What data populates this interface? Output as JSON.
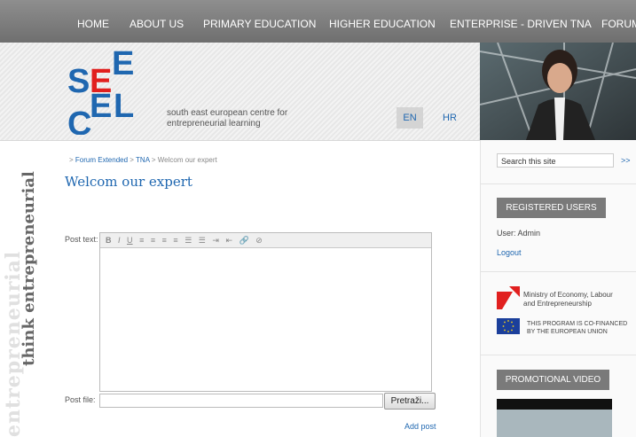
{
  "nav": {
    "items": [
      "HOME",
      "ABOUT US",
      "PRIMARY EDUCATION",
      "HIGHER EDUCATION",
      "ENTERPRISE - DRIVEN TNA",
      "FORUM"
    ]
  },
  "header": {
    "logo_letters": [
      "S",
      "E",
      "E",
      "C",
      "E",
      "L"
    ],
    "tagline": "south east european centre for entrepreneurial learning",
    "lang_en": "EN",
    "lang_hr": "HR"
  },
  "side_slogan": {
    "back": "entrepreneurial",
    "front": "think entrepreneurial"
  },
  "breadcrumb": {
    "prefix": ">",
    "items": [
      "Forum Extended",
      "TNA",
      "Welcom our expert"
    ],
    "sep": ">"
  },
  "page_title": "Welcom our expert",
  "form": {
    "post_text_label": "Post text:",
    "toolbar": [
      "B",
      "I",
      "U",
      "≡",
      "≡",
      "≡",
      "≡",
      "☰",
      "☰",
      "⇥",
      "⇤",
      "🔗",
      "⊘"
    ],
    "post_file_label": "Post file:",
    "browse_label": "Pretraži...",
    "add_post_label": "Add post",
    "post_text_value": "",
    "post_file_value": ""
  },
  "sidebar": {
    "search_value": "Search this site",
    "search_go": ">>",
    "registered_users": "REGISTERED USERS",
    "user_line": "User: Admin",
    "logout": "Logout",
    "ministry": [
      "Ministry of Economy, Labour",
      "and Entrepreneurship"
    ],
    "eu": [
      "THIS PROGRAM IS CO-FINANCED",
      "BY THE EUROPEAN UNION"
    ],
    "promo_video": "PROMOTIONAL VIDEO"
  },
  "colors": {
    "link": "#1f67b0",
    "logo_blue": "#1f67b0",
    "nav_bg": "#7a7a7a",
    "ministry_red": "#e1201f",
    "eu_blue": "#1b3f9b"
  }
}
